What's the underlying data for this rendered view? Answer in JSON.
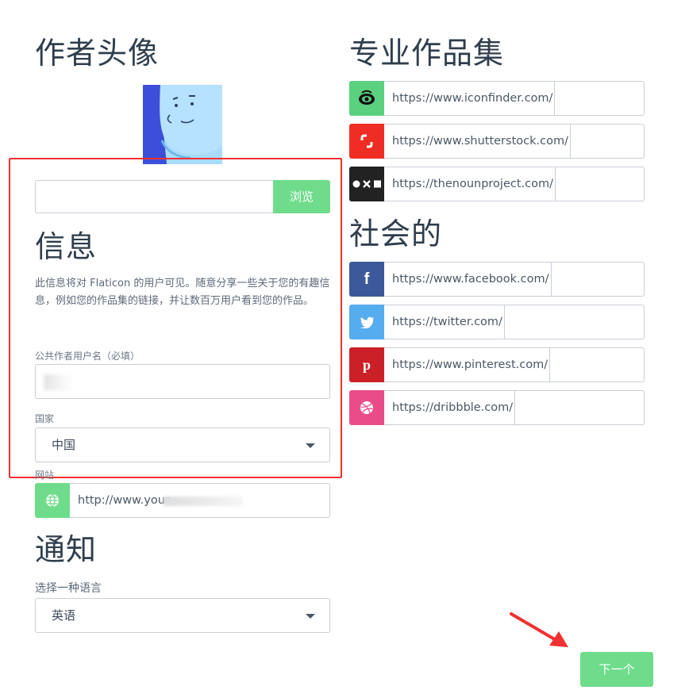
{
  "left": {
    "avatar_title": "作者头像",
    "browse_label": "浏览",
    "info_title": "信息",
    "info_desc": "此信息将对 Flaticon 的用户可见。随意分享一些关于您的有趣信息，例如您的作品集的链接，并让数百万用户看到您的作品。",
    "username_label": "公共作者用户名（必填）",
    "username_value": "",
    "country_label": "国家",
    "country_value": "中国",
    "website_label": "网站",
    "website_value": "http://www.your",
    "notify_title": "通知",
    "language_label": "选择一种语言",
    "language_value": "英语"
  },
  "right": {
    "portfolio_title": "专业作品集",
    "portfolio": [
      {
        "prefix": "https://www.iconfinder.com/",
        "icon": "iconfinder-icon",
        "color": "#5bd07e"
      },
      {
        "prefix": "https://www.shutterstock.com/",
        "icon": "shutterstock-icon",
        "color": "#ee2e24"
      },
      {
        "prefix": "https://thenounproject.com/",
        "icon": "nounproject-icon",
        "color": "#222222"
      }
    ],
    "social_title": "社会的",
    "social": [
      {
        "prefix": "https://www.facebook.com/",
        "icon": "facebook-icon",
        "color": "#3b5998"
      },
      {
        "prefix": "https://twitter.com/",
        "icon": "twitter-icon",
        "color": "#55acee"
      },
      {
        "prefix": "https://www.pinterest.com/",
        "icon": "pinterest-icon",
        "color": "#cb2027"
      },
      {
        "prefix": "https://dribbble.com/",
        "icon": "dribbble-icon",
        "color": "#ea4c89"
      }
    ]
  },
  "next_label": "下一个",
  "colors": {
    "accent": "#6fdc8c",
    "annotation": "#f0312f"
  }
}
